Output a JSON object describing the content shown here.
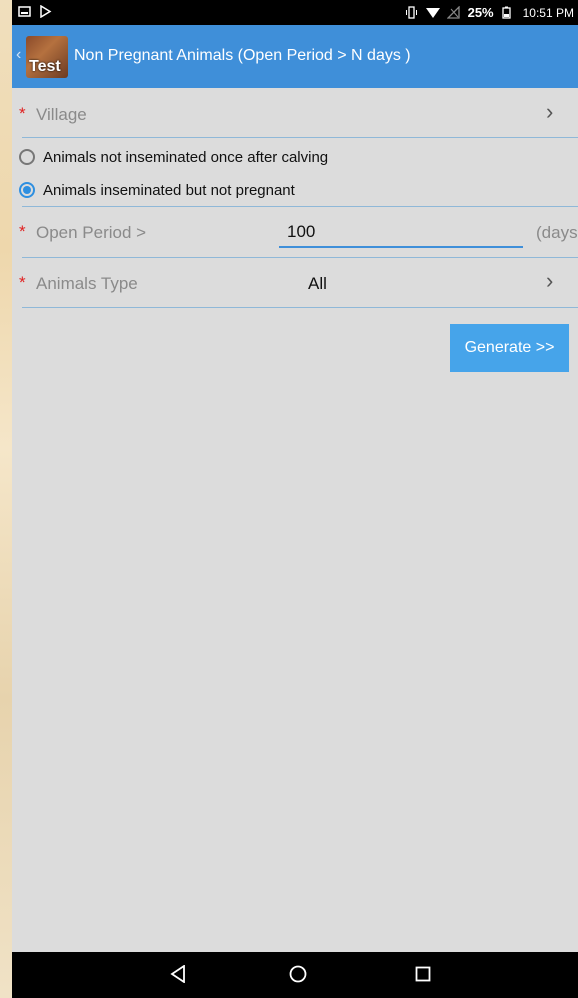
{
  "status_bar": {
    "battery_percent": "25%",
    "time": "10:51 PM",
    "icons": [
      "notification-image-icon",
      "play-store-icon",
      "vibrate-icon",
      "wifi-icon",
      "no-signal-icon",
      "battery-icon"
    ]
  },
  "action_bar": {
    "app_icon_label": "Test",
    "title": "Non Pregnant Animals (Open Period > N days )",
    "back_icon": "chevron-left-icon",
    "color": "#3f8fd9"
  },
  "form": {
    "required_mark": "*",
    "village": {
      "label": "Village",
      "value": ""
    },
    "radio_options": [
      {
        "label": "Animals not inseminated once after calving",
        "checked": false
      },
      {
        "label": "Animals inseminated but not pregnant",
        "checked": true
      }
    ],
    "open_period": {
      "label": "Open Period >",
      "value": "100",
      "unit": "(days"
    },
    "animals_type": {
      "label": "Animals Type",
      "value": "All"
    },
    "generate_label": "Generate >>"
  },
  "nav_bar": {
    "buttons": [
      "back-triangle-icon",
      "home-circle-icon",
      "recents-square-icon"
    ]
  }
}
